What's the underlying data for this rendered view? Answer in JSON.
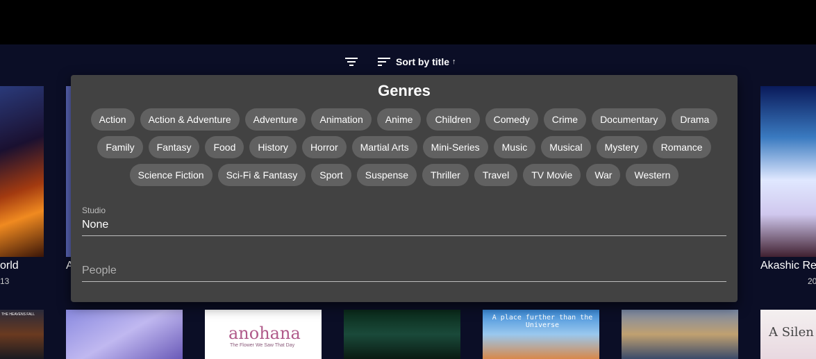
{
  "toolbar": {
    "filter_icon": "filter-icon",
    "sort_icon": "sort-icon",
    "sort_label": "Sort by title",
    "sort_direction": "↑"
  },
  "cards": [
    {
      "title": "orld",
      "sub": "13"
    },
    {
      "title": "A",
      "sub": ""
    },
    {
      "title": "Akashic Re",
      "sub": "20"
    }
  ],
  "posters_bottom": [
    {
      "caption": "THE HEAVENS FALL"
    },
    {
      "caption": ""
    },
    {
      "caption": "anohana",
      "subcaption": "The Flower We Saw That Day"
    },
    {
      "caption": ""
    },
    {
      "caption": "A place further than the Universe"
    },
    {
      "caption": ""
    },
    {
      "caption": "A Silen"
    }
  ],
  "filter_panel": {
    "title": "Genres",
    "genres": [
      "Action",
      "Action & Adventure",
      "Adventure",
      "Animation",
      "Anime",
      "Children",
      "Comedy",
      "Crime",
      "Documentary",
      "Drama",
      "Family",
      "Fantasy",
      "Food",
      "History",
      "Horror",
      "Martial Arts",
      "Mini-Series",
      "Music",
      "Musical",
      "Mystery",
      "Romance",
      "Science Fiction",
      "Sci-Fi & Fantasy",
      "Sport",
      "Suspense",
      "Thriller",
      "Travel",
      "TV Movie",
      "War",
      "Western"
    ],
    "studio": {
      "label": "Studio",
      "value": "None"
    },
    "people": {
      "placeholder": "People"
    }
  },
  "colors": {
    "background": "#0b0e26",
    "panel": "#424242",
    "chip": "#616161"
  }
}
